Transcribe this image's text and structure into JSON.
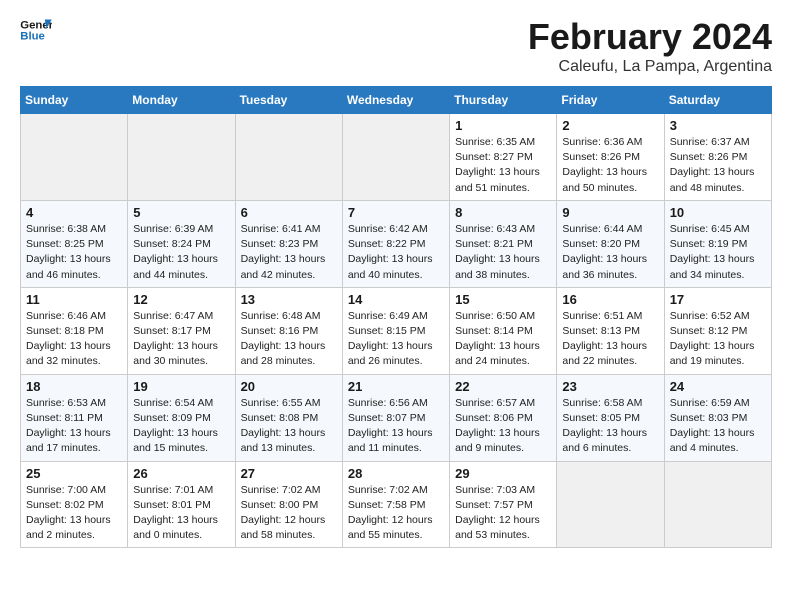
{
  "header": {
    "logo_line1": "General",
    "logo_line2": "Blue",
    "month_title": "February 2024",
    "location": "Caleufu, La Pampa, Argentina"
  },
  "weekdays": [
    "Sunday",
    "Monday",
    "Tuesday",
    "Wednesday",
    "Thursday",
    "Friday",
    "Saturday"
  ],
  "weeks": [
    [
      {
        "day": "",
        "empty": true
      },
      {
        "day": "",
        "empty": true
      },
      {
        "day": "",
        "empty": true
      },
      {
        "day": "",
        "empty": true
      },
      {
        "day": "1",
        "sunrise": "6:35 AM",
        "sunset": "8:27 PM",
        "daylight": "13 hours and 51 minutes."
      },
      {
        "day": "2",
        "sunrise": "6:36 AM",
        "sunset": "8:26 PM",
        "daylight": "13 hours and 50 minutes."
      },
      {
        "day": "3",
        "sunrise": "6:37 AM",
        "sunset": "8:26 PM",
        "daylight": "13 hours and 48 minutes."
      }
    ],
    [
      {
        "day": "4",
        "sunrise": "6:38 AM",
        "sunset": "8:25 PM",
        "daylight": "13 hours and 46 minutes."
      },
      {
        "day": "5",
        "sunrise": "6:39 AM",
        "sunset": "8:24 PM",
        "daylight": "13 hours and 44 minutes."
      },
      {
        "day": "6",
        "sunrise": "6:41 AM",
        "sunset": "8:23 PM",
        "daylight": "13 hours and 42 minutes."
      },
      {
        "day": "7",
        "sunrise": "6:42 AM",
        "sunset": "8:22 PM",
        "daylight": "13 hours and 40 minutes."
      },
      {
        "day": "8",
        "sunrise": "6:43 AM",
        "sunset": "8:21 PM",
        "daylight": "13 hours and 38 minutes."
      },
      {
        "day": "9",
        "sunrise": "6:44 AM",
        "sunset": "8:20 PM",
        "daylight": "13 hours and 36 minutes."
      },
      {
        "day": "10",
        "sunrise": "6:45 AM",
        "sunset": "8:19 PM",
        "daylight": "13 hours and 34 minutes."
      }
    ],
    [
      {
        "day": "11",
        "sunrise": "6:46 AM",
        "sunset": "8:18 PM",
        "daylight": "13 hours and 32 minutes."
      },
      {
        "day": "12",
        "sunrise": "6:47 AM",
        "sunset": "8:17 PM",
        "daylight": "13 hours and 30 minutes."
      },
      {
        "day": "13",
        "sunrise": "6:48 AM",
        "sunset": "8:16 PM",
        "daylight": "13 hours and 28 minutes."
      },
      {
        "day": "14",
        "sunrise": "6:49 AM",
        "sunset": "8:15 PM",
        "daylight": "13 hours and 26 minutes."
      },
      {
        "day": "15",
        "sunrise": "6:50 AM",
        "sunset": "8:14 PM",
        "daylight": "13 hours and 24 minutes."
      },
      {
        "day": "16",
        "sunrise": "6:51 AM",
        "sunset": "8:13 PM",
        "daylight": "13 hours and 22 minutes."
      },
      {
        "day": "17",
        "sunrise": "6:52 AM",
        "sunset": "8:12 PM",
        "daylight": "13 hours and 19 minutes."
      }
    ],
    [
      {
        "day": "18",
        "sunrise": "6:53 AM",
        "sunset": "8:11 PM",
        "daylight": "13 hours and 17 minutes."
      },
      {
        "day": "19",
        "sunrise": "6:54 AM",
        "sunset": "8:09 PM",
        "daylight": "13 hours and 15 minutes."
      },
      {
        "day": "20",
        "sunrise": "6:55 AM",
        "sunset": "8:08 PM",
        "daylight": "13 hours and 13 minutes."
      },
      {
        "day": "21",
        "sunrise": "6:56 AM",
        "sunset": "8:07 PM",
        "daylight": "13 hours and 11 minutes."
      },
      {
        "day": "22",
        "sunrise": "6:57 AM",
        "sunset": "8:06 PM",
        "daylight": "13 hours and 9 minutes."
      },
      {
        "day": "23",
        "sunrise": "6:58 AM",
        "sunset": "8:05 PM",
        "daylight": "13 hours and 6 minutes."
      },
      {
        "day": "24",
        "sunrise": "6:59 AM",
        "sunset": "8:03 PM",
        "daylight": "13 hours and 4 minutes."
      }
    ],
    [
      {
        "day": "25",
        "sunrise": "7:00 AM",
        "sunset": "8:02 PM",
        "daylight": "13 hours and 2 minutes."
      },
      {
        "day": "26",
        "sunrise": "7:01 AM",
        "sunset": "8:01 PM",
        "daylight": "13 hours and 0 minutes."
      },
      {
        "day": "27",
        "sunrise": "7:02 AM",
        "sunset": "8:00 PM",
        "daylight": "12 hours and 58 minutes."
      },
      {
        "day": "28",
        "sunrise": "7:02 AM",
        "sunset": "7:58 PM",
        "daylight": "12 hours and 55 minutes."
      },
      {
        "day": "29",
        "sunrise": "7:03 AM",
        "sunset": "7:57 PM",
        "daylight": "12 hours and 53 minutes."
      },
      {
        "day": "",
        "empty": true
      },
      {
        "day": "",
        "empty": true
      }
    ]
  ],
  "labels": {
    "sunrise_label": "Sunrise:",
    "sunset_label": "Sunset:",
    "daylight_label": "Daylight:"
  }
}
